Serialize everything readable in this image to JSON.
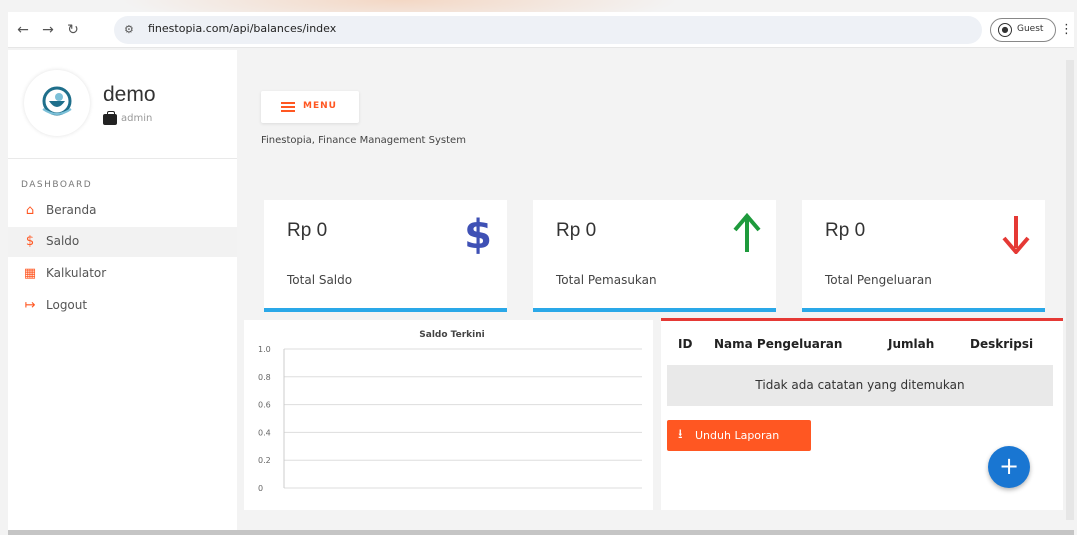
{
  "browser": {
    "url": "finestopia.com/api/balances/index",
    "profile_label": "Guest"
  },
  "sidebar": {
    "user_name": "demo",
    "user_role": "admin",
    "section_title": "DASHBOARD",
    "items": [
      {
        "label": "Beranda",
        "icon": "home-icon"
      },
      {
        "label": "Saldo",
        "icon": "dollar-icon"
      },
      {
        "label": "Kalkulator",
        "icon": "calculator-icon"
      },
      {
        "label": "Logout",
        "icon": "logout-icon"
      }
    ]
  },
  "header": {
    "menu_label": "MENU",
    "subtitle": "Finestopia, Finance Management System"
  },
  "stats": [
    {
      "value": "Rp 0",
      "label": "Total Saldo",
      "icon": "dollar-icon",
      "color": "#3f51b5"
    },
    {
      "value": "Rp 0",
      "label": "Total Pemasukan",
      "icon": "arrow-up-icon",
      "color": "#1e9a3c"
    },
    {
      "value": "Rp 0",
      "label": "Total Pengeluaran",
      "icon": "arrow-down-icon",
      "color": "#e53935"
    }
  ],
  "chart_data": {
    "type": "line",
    "title": "Saldo Terkini",
    "xlabel": "",
    "ylabel": "",
    "ylim": [
      0,
      1.0
    ],
    "y_ticks": [
      "1.0",
      "0.8",
      "0.6",
      "0.4",
      "0.2",
      "0"
    ],
    "categories": [],
    "series": [],
    "grid": true
  },
  "table": {
    "columns": [
      "ID",
      "Nama Pengeluaran",
      "Jumlah",
      "Deskripsi"
    ],
    "empty_text": "Tidak ada catatan yang ditemukan",
    "download_label": "Unduh Laporan"
  },
  "colors": {
    "accent": "#ff5722",
    "primary": "#1976d2",
    "card_border": "#2aa8e8"
  }
}
